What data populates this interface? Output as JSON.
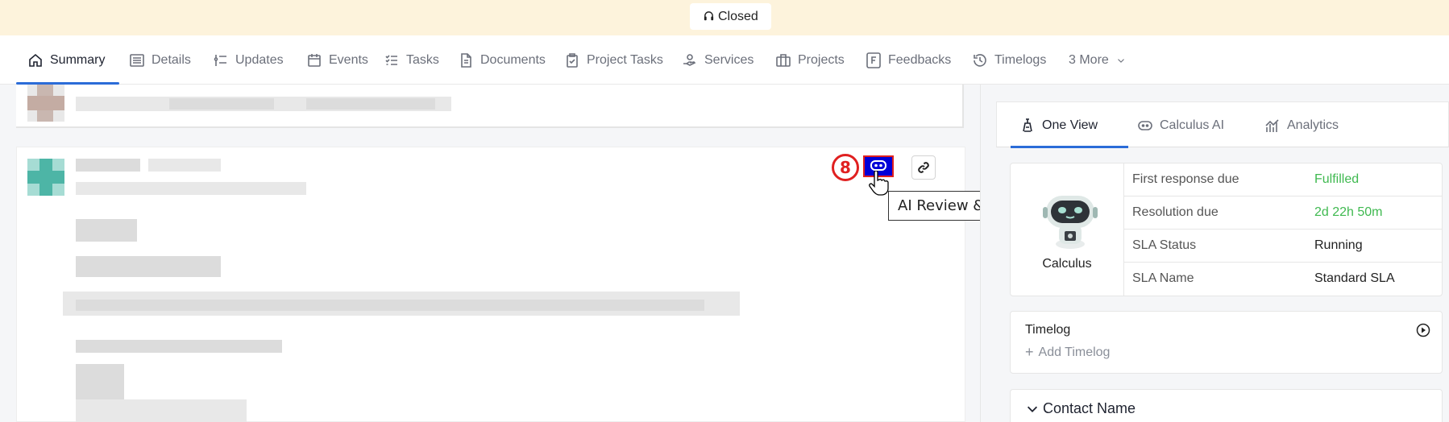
{
  "banner": {
    "status_label": "Closed"
  },
  "tabs": [
    {
      "label": "Summary",
      "active": true
    },
    {
      "label": "Details"
    },
    {
      "label": "Updates"
    },
    {
      "label": "Events"
    },
    {
      "label": "Tasks"
    },
    {
      "label": "Documents"
    },
    {
      "label": "Project Tasks"
    },
    {
      "label": "Services"
    },
    {
      "label": "Projects"
    },
    {
      "label": "Feedbacks"
    },
    {
      "label": "Timelogs"
    },
    {
      "label": "3 More"
    }
  ],
  "feed": {
    "step_badge": "8",
    "tooltip": "AI Review & Insights"
  },
  "right_panel": {
    "tabs": [
      {
        "label": "One View",
        "active": true
      },
      {
        "label": "Calculus AI"
      },
      {
        "label": "Analytics"
      }
    ],
    "sla": {
      "bot_name": "Calculus",
      "rows": [
        {
          "key": "First response due",
          "value": "Fulfilled",
          "color": "#3fb950"
        },
        {
          "key": "Resolution due",
          "value": "2d 22h 50m",
          "color": "#3fb950"
        },
        {
          "key": "SLA Status",
          "value": "Running"
        },
        {
          "key": "SLA Name",
          "value": "Standard SLA"
        }
      ]
    },
    "timelog": {
      "title": "Timelog",
      "add_label": "Add Timelog"
    },
    "contact": {
      "title": "Contact Name"
    }
  },
  "colors": {
    "accent": "#2b6cd8",
    "highlight_button": "#0000d8",
    "annotation_red": "#e02020",
    "banner_bg": "#fdf3dc"
  }
}
